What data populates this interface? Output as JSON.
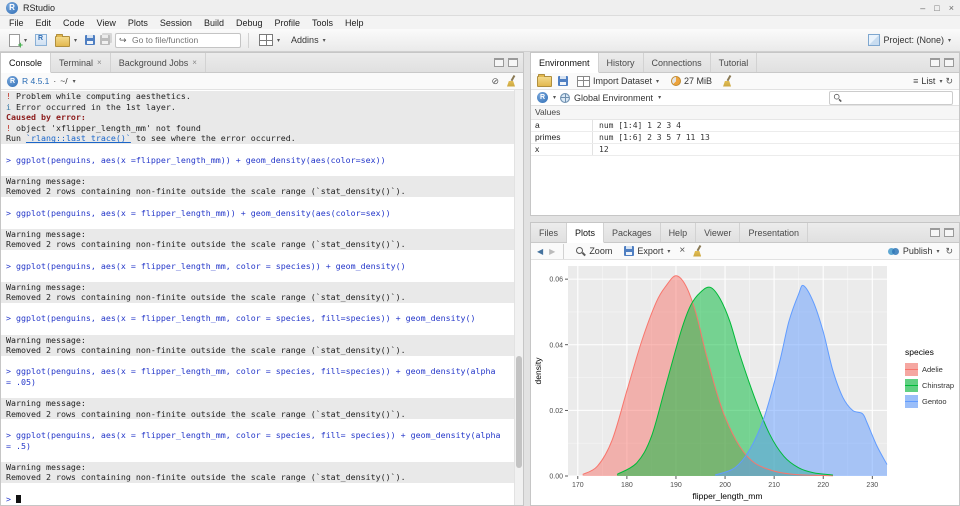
{
  "titlebar": {
    "title": "RStudio"
  },
  "menubar": {
    "items": [
      "File",
      "Edit",
      "Code",
      "View",
      "Plots",
      "Session",
      "Build",
      "Debug",
      "Profile",
      "Tools",
      "Help"
    ]
  },
  "toolbar": {
    "goto_placeholder": "Go to file/function",
    "addins_label": "Addins",
    "project_label": "Project: (None)"
  },
  "console": {
    "tabs": [
      {
        "label": "Console",
        "active": true,
        "closable": false
      },
      {
        "label": "Terminal",
        "active": false,
        "closable": true
      },
      {
        "label": "Background Jobs",
        "active": false,
        "closable": true
      }
    ],
    "header": {
      "version_label": "R 4.5.1",
      "separator": "·",
      "path_label": "~/"
    },
    "lines": [
      {
        "c": "band",
        "segs": [
          {
            "t": "! ",
            "c": "red"
          },
          {
            "t": "Problem while computing aesthetics.",
            "c": "plain"
          }
        ]
      },
      {
        "c": "band",
        "segs": [
          {
            "t": "i ",
            "c": "info"
          },
          {
            "t": "Error occurred in the 1st layer.",
            "c": "plain"
          }
        ]
      },
      {
        "c": "band",
        "segs": [
          {
            "t": "Caused by error:",
            "c": "errbold"
          }
        ]
      },
      {
        "c": "band",
        "segs": [
          {
            "t": "! ",
            "c": "red"
          },
          {
            "t": "object 'xflipper_length_mm' not found",
            "c": "plain"
          }
        ]
      },
      {
        "c": "band",
        "segs": [
          {
            "t": "Run ",
            "c": "plain"
          },
          {
            "t": "`rlang::last_trace()`",
            "c": "link"
          },
          {
            "t": " to see where the error occurred.",
            "c": "plain"
          }
        ]
      },
      {
        "c": "blank"
      },
      {
        "c": "cmd",
        "t": "> ggplot(penguins, aes(x =flipper_length_mm)) + geom_density(aes(color=sex))"
      },
      {
        "c": "blank"
      },
      {
        "c": "band",
        "t": "Warning message:"
      },
      {
        "c": "band",
        "t": "Removed 2 rows containing non-finite outside the scale range (`stat_density()`)."
      },
      {
        "c": "blank"
      },
      {
        "c": "cmd",
        "t": "> ggplot(penguins, aes(x = flipper_length_mm)) + geom_density(aes(color=sex))"
      },
      {
        "c": "blank"
      },
      {
        "c": "band",
        "t": "Warning message:"
      },
      {
        "c": "band",
        "t": "Removed 2 rows containing non-finite outside the scale range (`stat_density()`)."
      },
      {
        "c": "blank"
      },
      {
        "c": "cmd",
        "t": "> ggplot(penguins, aes(x = flipper_length_mm, color = species)) + geom_density()"
      },
      {
        "c": "blank"
      },
      {
        "c": "band",
        "t": "Warning message:"
      },
      {
        "c": "band",
        "t": "Removed 2 rows containing non-finite outside the scale range (`stat_density()`)."
      },
      {
        "c": "blank"
      },
      {
        "c": "cmd",
        "t": "> ggplot(penguins, aes(x = flipper_length_mm, color = species, fill=species)) + geom_density()"
      },
      {
        "c": "blank"
      },
      {
        "c": "band",
        "t": "Warning message:"
      },
      {
        "c": "band",
        "t": "Removed 2 rows containing non-finite outside the scale range (`stat_density()`)."
      },
      {
        "c": "blank"
      },
      {
        "c": "cmd",
        "t": "> ggplot(penguins, aes(x = flipper_length_mm, color = species, fill=species)) + geom_density(alpha"
      },
      {
        "c": "cmd",
        "t": "= .05)"
      },
      {
        "c": "blank"
      },
      {
        "c": "band",
        "t": "Warning message:"
      },
      {
        "c": "band",
        "t": "Removed 2 rows containing non-finite outside the scale range (`stat_density()`)."
      },
      {
        "c": "blank"
      },
      {
        "c": "cmd",
        "t": "> ggplot(penguins, aes(x = flipper_length_mm, color = species, fill= species)) + geom_density(alpha"
      },
      {
        "c": "cmd",
        "t": "= .5)"
      },
      {
        "c": "blank"
      },
      {
        "c": "band",
        "t": "Warning message:"
      },
      {
        "c": "band",
        "t": "Removed 2 rows containing non-finite outside the scale range (`stat_density()`)."
      },
      {
        "c": "blank"
      },
      {
        "c": "cmd",
        "t": "> ",
        "cursor": true
      }
    ]
  },
  "environment": {
    "tabs": [
      {
        "label": "Environment",
        "active": true
      },
      {
        "label": "History"
      },
      {
        "label": "Connections"
      },
      {
        "label": "Tutorial"
      }
    ],
    "toolbar": {
      "import_label": "Import Dataset",
      "memory_label": "27 MiB",
      "list_label": "List"
    },
    "scope": {
      "language_label": "R",
      "env_label": "Global Environment"
    },
    "section_label": "Values",
    "variables": [
      {
        "name": "a",
        "value": "num [1:4] 1 2 3 4"
      },
      {
        "name": "primes",
        "value": "num [1:6] 2 3 5 7 11 13"
      },
      {
        "name": "x",
        "value": "12"
      }
    ]
  },
  "plots": {
    "tabs": [
      {
        "label": "Files"
      },
      {
        "label": "Plots",
        "active": true
      },
      {
        "label": "Packages"
      },
      {
        "label": "Help"
      },
      {
        "label": "Viewer"
      },
      {
        "label": "Presentation"
      }
    ],
    "toolbar": {
      "zoom_label": "Zoom",
      "export_label": "Export",
      "publish_label": "Publish"
    }
  },
  "chart_data": {
    "type": "area",
    "title": "",
    "xlabel": "flipper_length_mm",
    "ylabel": "density",
    "legend_title": "species",
    "legend_position": "right",
    "panel_bg": "#ebebeb",
    "fill_alpha": 0.5,
    "xlim": [
      168,
      233
    ],
    "ylim": [
      0,
      0.064
    ],
    "xticks": [
      170,
      180,
      190,
      200,
      210,
      220,
      230
    ],
    "xtick_labels": [
      "170",
      "180",
      "190",
      "200",
      "210",
      "220",
      "230"
    ],
    "yticks": [
      0,
      0.02,
      0.04,
      0.06
    ],
    "ytick_labels": [
      "0.00",
      "0.02",
      "0.04",
      "0.06"
    ],
    "x_minor": [
      175,
      185,
      195,
      205,
      215,
      225
    ],
    "y_minor": [
      0.01,
      0.03,
      0.05
    ],
    "series": [
      {
        "name": "Adelie",
        "color": "#F8766D",
        "points": [
          [
            171,
            0.0005
          ],
          [
            174,
            0.003
          ],
          [
            177,
            0.011
          ],
          [
            180,
            0.026
          ],
          [
            183,
            0.041
          ],
          [
            186,
            0.053
          ],
          [
            188,
            0.058
          ],
          [
            190,
            0.061
          ],
          [
            192,
            0.058
          ],
          [
            194,
            0.05
          ],
          [
            196,
            0.038
          ],
          [
            198,
            0.027
          ],
          [
            200,
            0.018
          ],
          [
            203,
            0.009
          ],
          [
            206,
            0.004
          ],
          [
            210,
            0.0015
          ],
          [
            214,
            0.0005
          ],
          [
            218,
            0.0002
          ],
          [
            222,
            0.0001
          ]
        ]
      },
      {
        "name": "Chinstrap",
        "color": "#00BA38",
        "points": [
          [
            178,
            0.0005
          ],
          [
            182,
            0.004
          ],
          [
            185,
            0.012
          ],
          [
            188,
            0.028
          ],
          [
            191,
            0.044
          ],
          [
            193,
            0.052
          ],
          [
            195,
            0.056
          ],
          [
            197,
            0.0575
          ],
          [
            199,
            0.054
          ],
          [
            201,
            0.047
          ],
          [
            203,
            0.037
          ],
          [
            206,
            0.024
          ],
          [
            209,
            0.013
          ],
          [
            212,
            0.006
          ],
          [
            215,
            0.0025
          ],
          [
            218,
            0.001
          ],
          [
            222,
            0.0003
          ]
        ]
      },
      {
        "name": "Gentoo",
        "color": "#619CFF",
        "points": [
          [
            198,
            0.0003
          ],
          [
            202,
            0.0025
          ],
          [
            205,
            0.008
          ],
          [
            208,
            0.018
          ],
          [
            211,
            0.034
          ],
          [
            213,
            0.047
          ],
          [
            215,
            0.0555
          ],
          [
            216,
            0.058
          ],
          [
            218,
            0.053
          ],
          [
            220,
            0.044
          ],
          [
            222,
            0.032
          ],
          [
            224,
            0.024
          ],
          [
            226,
            0.02
          ],
          [
            228,
            0.019
          ],
          [
            229,
            0.016
          ],
          [
            231,
            0.009
          ],
          [
            233,
            0.0035
          ]
        ]
      }
    ]
  }
}
